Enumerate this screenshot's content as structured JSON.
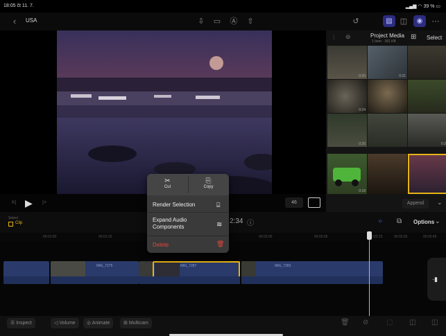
{
  "status_bar": {
    "time": "18:05",
    "date": "čt 11. 7.",
    "battery": "39 %"
  },
  "top_bar": {
    "back_label": "USA"
  },
  "media_browser": {
    "title": "Project Media",
    "subtitle": "1 Item · 391 KB",
    "select_label": "Select",
    "durations": [
      "0:20",
      "0:31",
      "0:24",
      "0:20",
      "0:18",
      "0:2",
      "0:18"
    ],
    "append_label": "Append"
  },
  "transport": {
    "zoom": "46"
  },
  "timeline": {
    "select_label": "Select",
    "clip_label": "Clip",
    "timecode": "2:34",
    "options_label": "Options",
    "ruler": [
      "00:01:50",
      "00:01:15",
      "00:02:00",
      "00:02:05",
      "00:02:15",
      "00:02:20",
      "00:02:45"
    ],
    "clips": [
      "IMG_7275",
      "IMG_7287",
      "IMG_7283"
    ]
  },
  "context_menu": {
    "cut_label": "Cut",
    "copy_label": "Copy",
    "render_label": "Render Selection",
    "expand_label": "Expand Audio Components",
    "delete_label": "Delete"
  },
  "bottom_bar": {
    "inspect_label": "Inspect",
    "volume_label": "Volume",
    "animate_label": "Animate",
    "multicam_label": "Multicam"
  },
  "colors": {
    "accent": "#e7b416",
    "selection": "#3f46a8",
    "delete": "#e0463e"
  }
}
